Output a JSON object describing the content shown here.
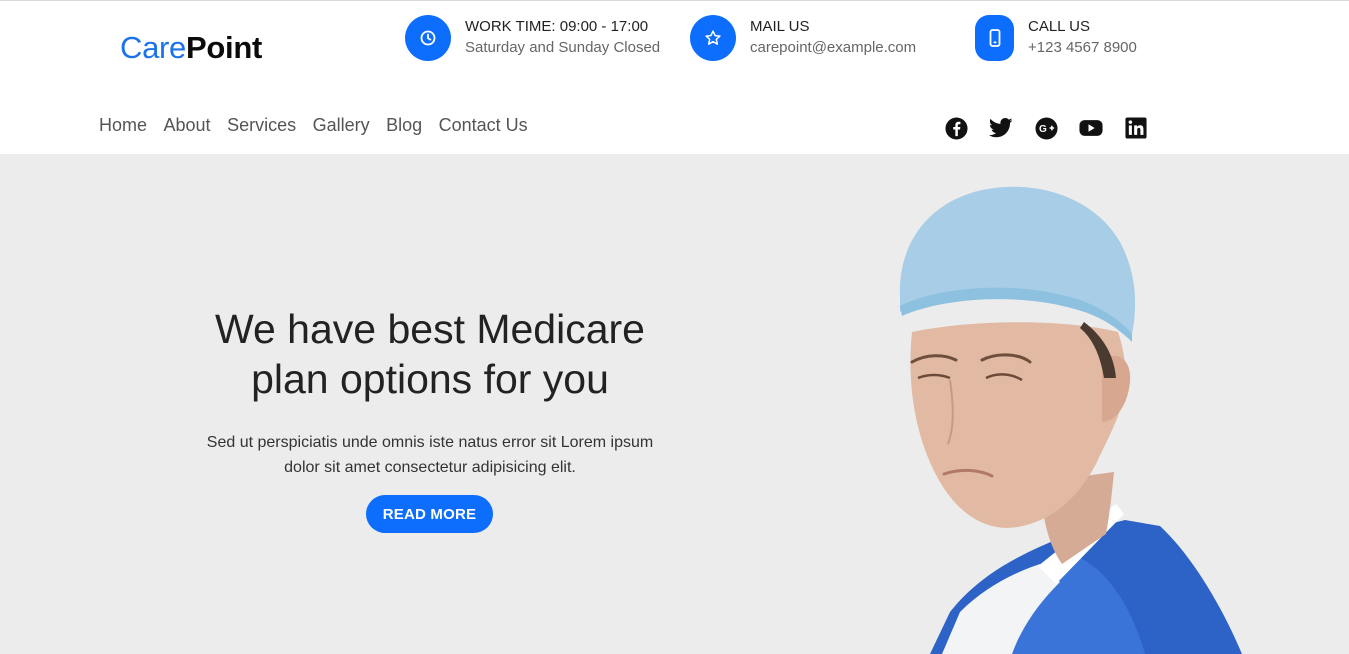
{
  "logo": {
    "part1": "Care",
    "part2": "Point"
  },
  "header_info": [
    {
      "icon": "clock-icon",
      "title": "WORK TIME: 09:00 - 17:00",
      "subtitle": "Saturday and Sunday Closed"
    },
    {
      "icon": "star-icon",
      "title": "MAIL US",
      "subtitle": "carepoint@example.com"
    },
    {
      "icon": "mobile-phone-icon",
      "title": "CALL US",
      "subtitle": "+123 4567 8900"
    }
  ],
  "nav": {
    "items": [
      "Home",
      "About",
      "Services",
      "Gallery",
      "Blog",
      "Contact Us"
    ]
  },
  "social": [
    "facebook-icon",
    "twitter-icon",
    "google-plus-icon",
    "youtube-icon",
    "linkedin-icon"
  ],
  "hero": {
    "line1": "We have best Medicare",
    "line2": "plan options for you",
    "text_line1": "Sed ut perspiciatis unde omnis iste natus error sit Lorem ipsum",
    "text_line2": "dolor sit amet consectetur adipisicing elit.",
    "button": "READ MORE"
  },
  "colors": {
    "accent": "#0d6efd",
    "hero_bg": "#ececec",
    "logo_care": "#1a73e8"
  }
}
